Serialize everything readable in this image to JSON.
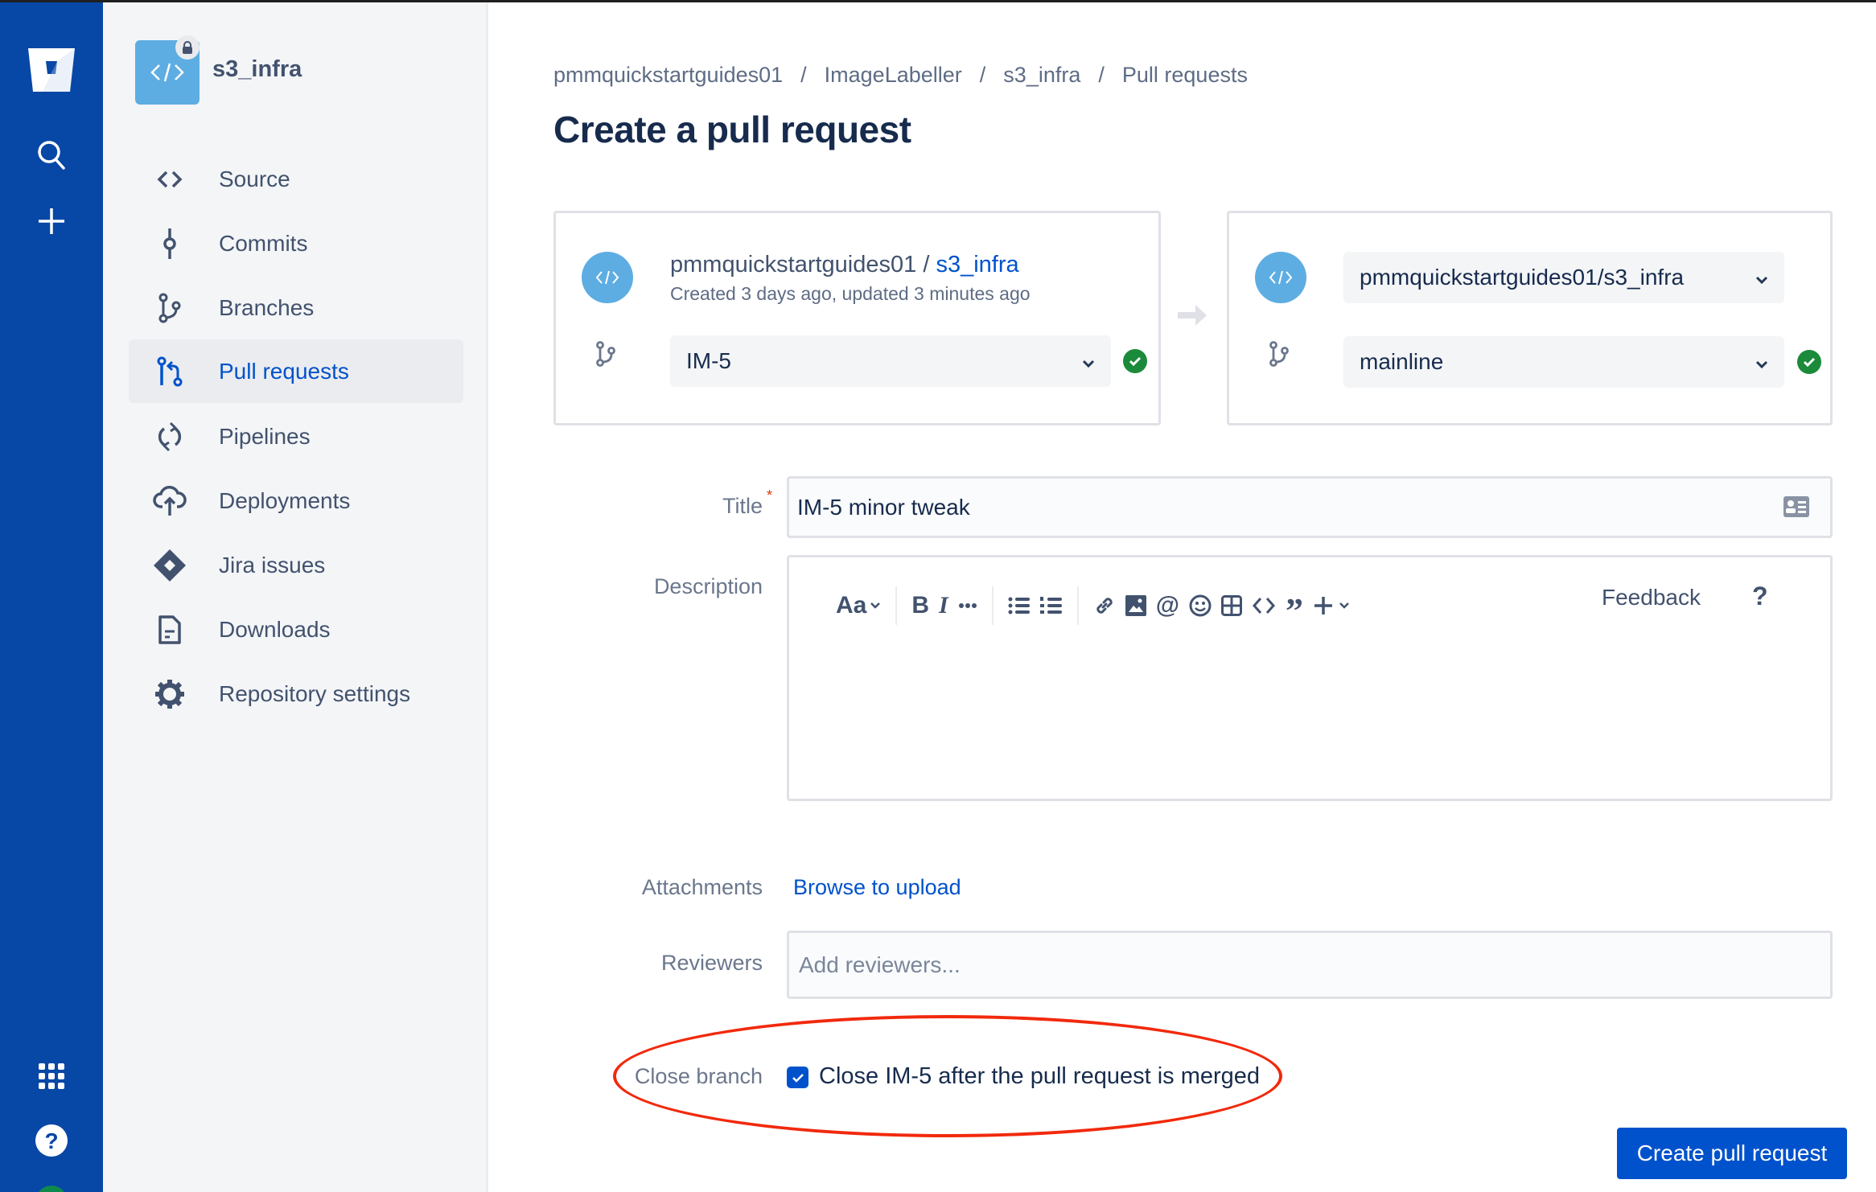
{
  "global_nav": {
    "icons": [
      "bitbucket-logo-icon",
      "search-icon",
      "create-plus-icon",
      "app-switcher-icon",
      "help-icon",
      "profile-avatar"
    ]
  },
  "sidebar": {
    "repo_name": "s3_infra",
    "items": [
      {
        "label": "Source",
        "icon": "source-code-icon",
        "active": false
      },
      {
        "label": "Commits",
        "icon": "commit-icon",
        "active": false
      },
      {
        "label": "Branches",
        "icon": "branch-icon",
        "active": false
      },
      {
        "label": "Pull requests",
        "icon": "pull-request-icon",
        "active": true
      },
      {
        "label": "Pipelines",
        "icon": "pipelines-icon",
        "active": false
      },
      {
        "label": "Deployments",
        "icon": "deployments-icon",
        "active": false
      },
      {
        "label": "Jira issues",
        "icon": "jira-icon",
        "active": false
      },
      {
        "label": "Downloads",
        "icon": "downloads-icon",
        "active": false
      },
      {
        "label": "Repository settings",
        "icon": "settings-gear-icon",
        "active": false
      }
    ]
  },
  "breadcrumbs": [
    "pmmquickstartguides01",
    "ImageLabeller",
    "s3_infra",
    "Pull requests"
  ],
  "breadcrumb_separator": "/",
  "page_title": "Create a pull request",
  "source": {
    "owner": "pmmquickstartguides01",
    "separator": " / ",
    "repo": "s3_infra",
    "meta": "Created 3 days ago, updated 3 minutes ago",
    "branch": "IM-5"
  },
  "destination": {
    "repo": "pmmquickstartguides01/s3_infra",
    "branch": "mainline"
  },
  "form": {
    "title_label": "Title",
    "title_required": "*",
    "title_value": "IM-5 minor tweak",
    "description_label": "Description",
    "toolbar": {
      "text_style": "Aa",
      "feedback": "Feedback",
      "help": "?"
    },
    "attachments_label": "Attachments",
    "attachments_link": "Browse to upload",
    "reviewers_label": "Reviewers",
    "reviewers_placeholder": "Add reviewers...",
    "close_branch_label": "Close branch",
    "close_branch_checked": true,
    "close_branch_text": "Close IM-5 after the pull request is merged",
    "submit": "Create pull request"
  },
  "colors": {
    "global_nav": "#0747A6",
    "accent": "#0052CC",
    "success": "#1B8A3A",
    "annotation": "#F2290C"
  }
}
